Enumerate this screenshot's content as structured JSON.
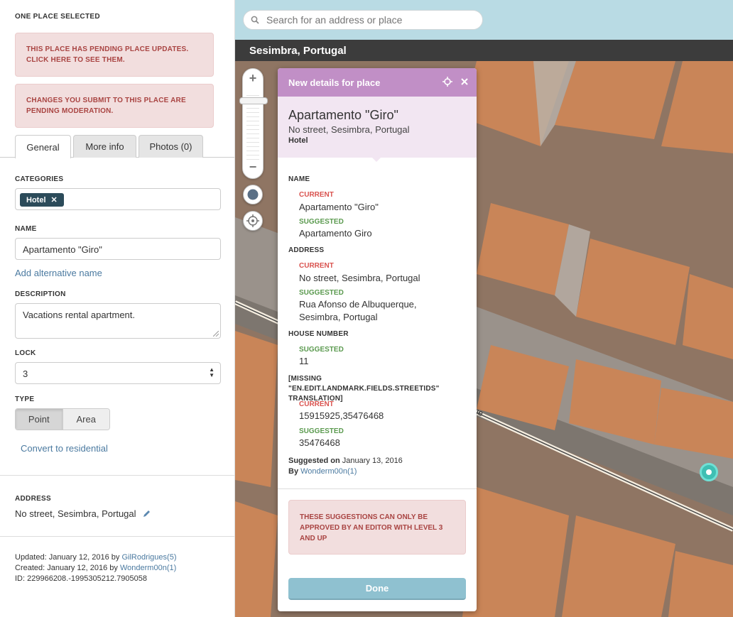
{
  "sidebar": {
    "header": "ONE PLACE SELECTED",
    "alerts": [
      "THIS PLACE HAS PENDING PLACE UPDATES. CLICK HERE TO SEE THEM.",
      "CHANGES YOU SUBMIT TO THIS PLACE ARE PENDING MODERATION."
    ],
    "tabs": [
      "General",
      "More info",
      "Photos (0)"
    ],
    "categories_label": "CATEGORIES",
    "category_chip": "Hotel",
    "name_label": "NAME",
    "name_value": "Apartamento \"Giro\"",
    "add_alt_name": "Add alternative name",
    "description_label": "DESCRIPTION",
    "description_value": "Vacations rental apartment.",
    "lock_label": "LOCK",
    "lock_value": "3",
    "type_label": "TYPE",
    "type_options": [
      "Point",
      "Area"
    ],
    "convert_link": "Convert to residential",
    "address_label": "ADDRESS",
    "address_value": "No street, Sesimbra, Portugal",
    "updated_prefix": "Updated: January 12, 2016 by ",
    "updated_user": "GilRodrigues(5)",
    "created_prefix": "Created: January 12, 2016 by ",
    "created_user": "Wonderm00n(1)",
    "id_text": "ID: 229966208.-1995305212.7905058"
  },
  "map": {
    "search_placeholder": "Search for an address or place",
    "location": "Sesimbra, Portugal",
    "street_label_fragment": "ue"
  },
  "popup": {
    "header": "New details for place",
    "title": "Apartamento \"Giro\"",
    "subtitle": "No street, Sesimbra, Portugal",
    "category": "Hotel",
    "name_label": "NAME",
    "current_label": "CURRENT",
    "suggested_label": "SUGGESTED",
    "name_current": "Apartamento \"Giro\"",
    "name_suggested": "Apartamento Giro",
    "address_label": "ADDRESS",
    "address_current": "No street, Sesimbra, Portugal",
    "address_suggested": "Rua Afonso de Albuquerque, Sesimbra, Portugal",
    "house_label": "HOUSE NUMBER",
    "house_suggested": "11",
    "missing_label": "[MISSING \"EN.EDIT.LANDMARK.FIELDS.STREETIDS\" TRANSLATION]",
    "street_current": "15915925,35476468",
    "street_suggested": "35476468",
    "suggested_on_label": "Suggested on",
    "suggested_on_date": " January 13, 2016",
    "by_label": "By",
    "by_user": "Wonderm00n(1)",
    "alert": "THESE SUGGESTIONS CAN ONLY BE APPROVED BY AN EDITOR WITH LEVEL 3 AND UP",
    "done_button": "Done"
  },
  "colors": {
    "popup_header": "#c18fc6",
    "popup_title_bg": "#f2e6f2",
    "alert_bg": "#f2dede",
    "alert_text": "#a94442",
    "current": "#d9534f",
    "suggested": "#5b9a4f",
    "link": "#4b7aa0",
    "done_button": "#8fc1d0",
    "chip": "#2c4b5a"
  }
}
